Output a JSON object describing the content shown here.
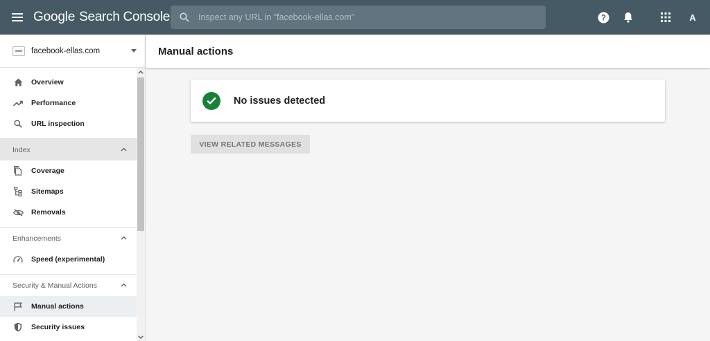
{
  "header": {
    "logo_google": "Google",
    "logo_product": "Search Console",
    "search_placeholder": "Inspect any URL in \"facebook-ellas.com\"",
    "avatar_letter": "A"
  },
  "sidebar": {
    "property": {
      "name": "facebook-ellas.com"
    },
    "top_items": [
      {
        "label": "Overview",
        "icon": "home-icon"
      },
      {
        "label": "Performance",
        "icon": "trending-up-icon"
      },
      {
        "label": "URL inspection",
        "icon": "search-icon"
      }
    ],
    "sections": {
      "index": {
        "label": "Index",
        "items": [
          {
            "label": "Coverage",
            "icon": "copy-icon"
          },
          {
            "label": "Sitemaps",
            "icon": "sitemap-icon"
          },
          {
            "label": "Removals",
            "icon": "eye-off-icon"
          }
        ]
      },
      "enhancements": {
        "label": "Enhancements",
        "items": [
          {
            "label": "Speed (experimental)",
            "icon": "speedometer-icon"
          }
        ]
      },
      "security": {
        "label": "Security & Manual Actions",
        "items": [
          {
            "label": "Manual actions",
            "icon": "flag-icon",
            "active": true
          },
          {
            "label": "Security issues",
            "icon": "shield-icon"
          }
        ]
      }
    }
  },
  "main": {
    "title": "Manual actions",
    "status": {
      "text": "No issues detected",
      "icon": "check-circle-icon"
    },
    "view_messages_button": "VIEW RELATED MESSAGES"
  },
  "colors": {
    "header_bg": "#455a64",
    "search_bg": "#62757f",
    "success": "#188038",
    "active_item_bg": "#eceff1"
  }
}
